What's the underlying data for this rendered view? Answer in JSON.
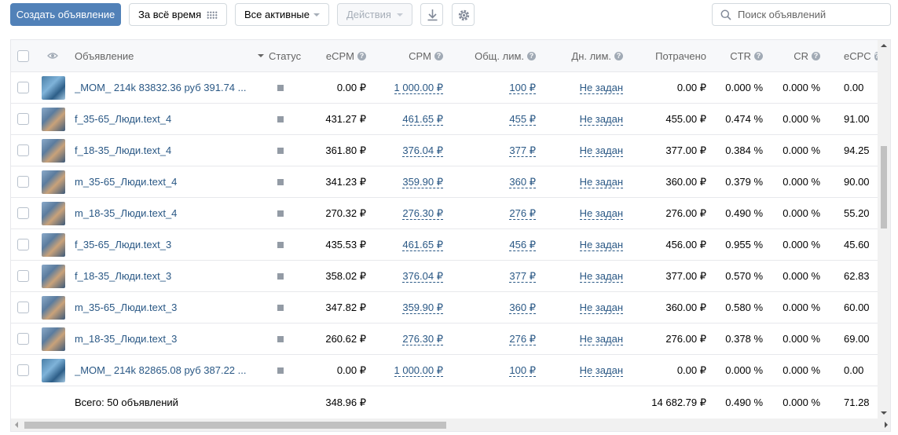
{
  "toolbar": {
    "create_label": "Создать объявление",
    "period_label": "За всё время",
    "filter_label": "Все активные",
    "actions_label": "Действия",
    "search_placeholder": "Поиск объявлений"
  },
  "columns": {
    "ad": "Объявление",
    "status": "Статус",
    "ecpm": "eCPM",
    "cpm": "CPM",
    "total_limit": "Общ. лим.",
    "day_limit": "Дн. лим.",
    "spent": "Потрачено",
    "ctr": "CTR",
    "cr": "CR",
    "ecpc": "eCPC"
  },
  "rows": [
    {
      "name": "_MOM_ 214k 83832.36 руб 391.74 ...",
      "ecpm": "0.00 ₽",
      "cpm": "1 000.00 ₽",
      "total_limit": "100 ₽",
      "day_limit": "Не задан",
      "spent": "0.00 ₽",
      "ctr": "0.000 %",
      "cr": "0.000 %",
      "ecpc": "0.00"
    },
    {
      "name": "f_35-65_Люди.text_4",
      "ecpm": "431.27 ₽",
      "cpm": "461.65 ₽",
      "total_limit": "455 ₽",
      "day_limit": "Не задан",
      "spent": "455.00 ₽",
      "ctr": "0.474 %",
      "cr": "0.000 %",
      "ecpc": "91.00"
    },
    {
      "name": "f_18-35_Люди.text_4",
      "ecpm": "361.80 ₽",
      "cpm": "376.04 ₽",
      "total_limit": "377 ₽",
      "day_limit": "Не задан",
      "spent": "377.00 ₽",
      "ctr": "0.384 %",
      "cr": "0.000 %",
      "ecpc": "94.25"
    },
    {
      "name": "m_35-65_Люди.text_4",
      "ecpm": "341.23 ₽",
      "cpm": "359.90 ₽",
      "total_limit": "360 ₽",
      "day_limit": "Не задан",
      "spent": "360.00 ₽",
      "ctr": "0.379 %",
      "cr": "0.000 %",
      "ecpc": "90.00"
    },
    {
      "name": "m_18-35_Люди.text_4",
      "ecpm": "270.32 ₽",
      "cpm": "276.30 ₽",
      "total_limit": "276 ₽",
      "day_limit": "Не задан",
      "spent": "276.00 ₽",
      "ctr": "0.490 %",
      "cr": "0.000 %",
      "ecpc": "55.20"
    },
    {
      "name": "f_35-65_Люди.text_3",
      "ecpm": "435.53 ₽",
      "cpm": "461.65 ₽",
      "total_limit": "456 ₽",
      "day_limit": "Не задан",
      "spent": "456.00 ₽",
      "ctr": "0.955 %",
      "cr": "0.000 %",
      "ecpc": "45.60"
    },
    {
      "name": "f_18-35_Люди.text_3",
      "ecpm": "358.02 ₽",
      "cpm": "376.04 ₽",
      "total_limit": "377 ₽",
      "day_limit": "Не задан",
      "spent": "377.00 ₽",
      "ctr": "0.570 %",
      "cr": "0.000 %",
      "ecpc": "62.83"
    },
    {
      "name": "m_35-65_Люди.text_3",
      "ecpm": "347.82 ₽",
      "cpm": "359.90 ₽",
      "total_limit": "360 ₽",
      "day_limit": "Не задан",
      "spent": "360.00 ₽",
      "ctr": "0.580 %",
      "cr": "0.000 %",
      "ecpc": "60.00"
    },
    {
      "name": "m_18-35_Люди.text_3",
      "ecpm": "260.62 ₽",
      "cpm": "276.30 ₽",
      "total_limit": "276 ₽",
      "day_limit": "Не задан",
      "spent": "276.00 ₽",
      "ctr": "0.378 %",
      "cr": "0.000 %",
      "ecpc": "69.00"
    },
    {
      "name": "_MOM_ 214k 82865.08 руб 387.22 ...",
      "ecpm": "0.00 ₽",
      "cpm": "1 000.00 ₽",
      "total_limit": "100 ₽",
      "day_limit": "Не задан",
      "spent": "0.00 ₽",
      "ctr": "0.000 %",
      "cr": "0.000 %",
      "ecpc": "0.00"
    }
  ],
  "totals": {
    "label": "Всего: 50 объявлений",
    "ecpm": "348.96 ₽",
    "spent": "14 682.79 ₽",
    "ctr": "0.490 %",
    "cr": "0.000 %",
    "ecpc": "71.28"
  },
  "colors": {
    "accent": "#5181b8",
    "link": "#2a5885"
  }
}
